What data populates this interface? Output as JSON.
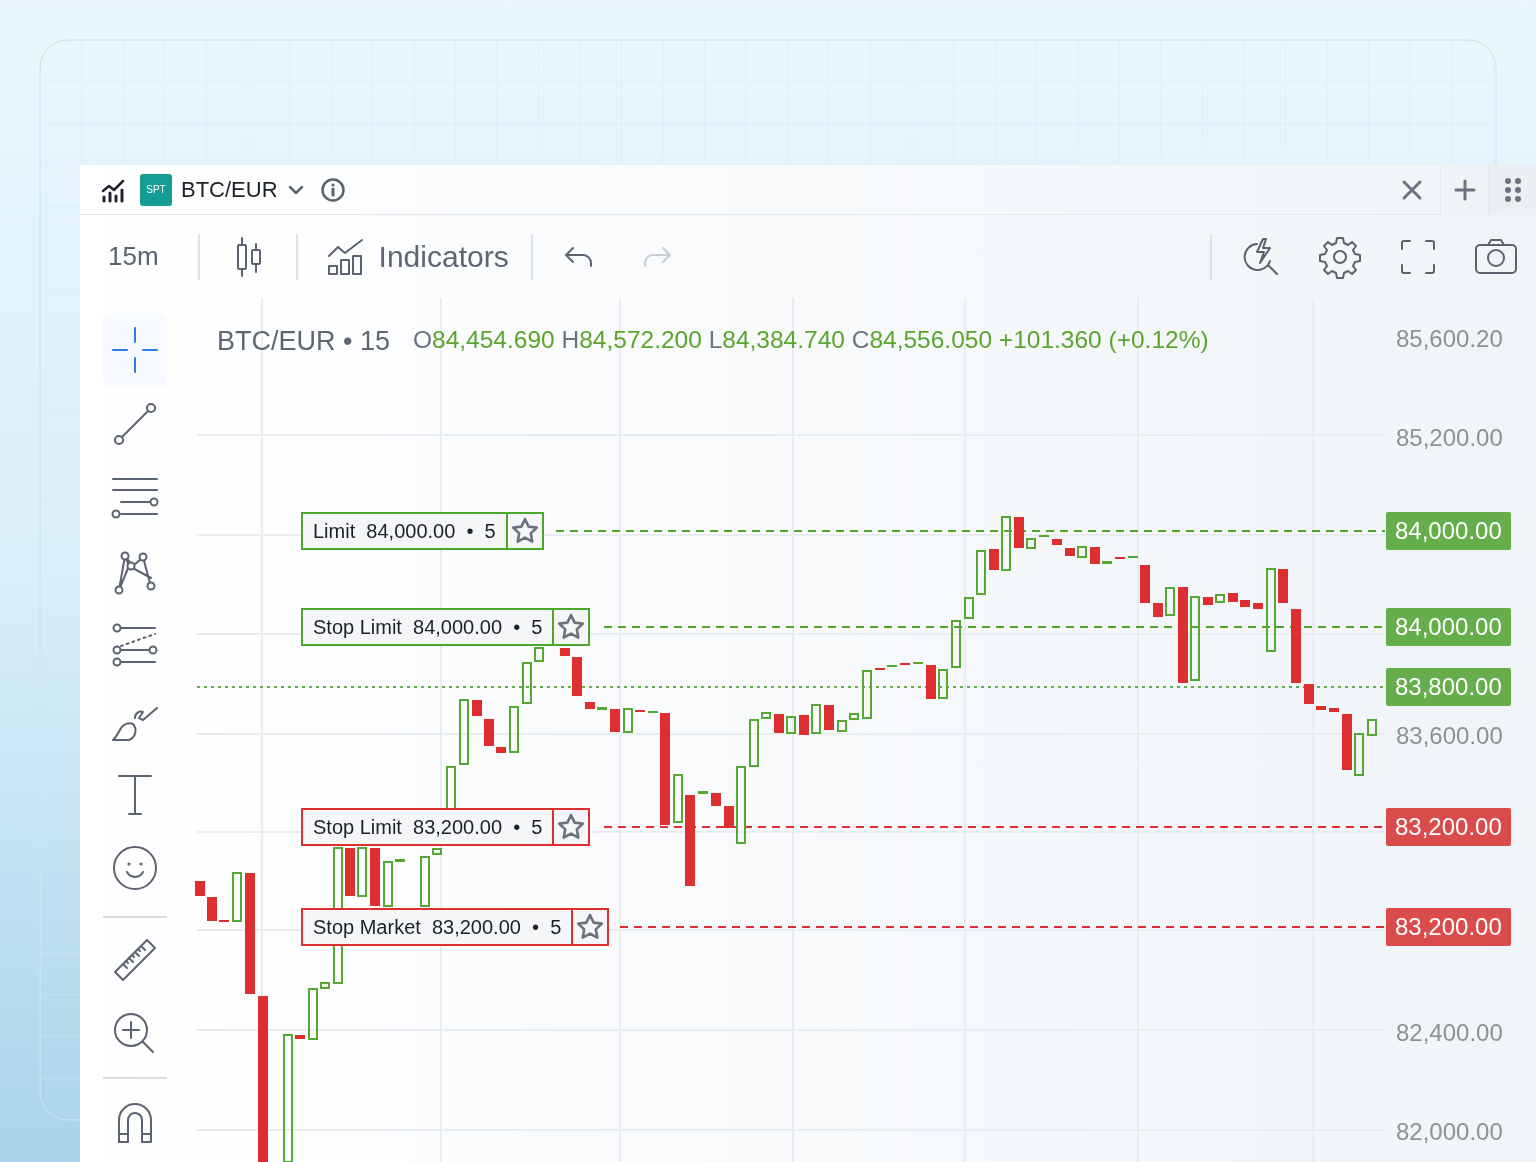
{
  "header": {
    "badge": "SPT",
    "symbol": "BTC/EUR"
  },
  "toolbar": {
    "interval": "15m",
    "indicators": "Indicators",
    "undo": {
      "disabled": false
    },
    "redo": {
      "disabled": true
    }
  },
  "tool_groups": [
    {
      "tools": [
        {
          "kind": "crosshair",
          "selected": true
        },
        {
          "kind": "trend-line",
          "selected": false
        },
        {
          "kind": "levels",
          "selected": false
        },
        {
          "kind": "pattern",
          "selected": false
        },
        {
          "kind": "channel",
          "selected": false
        },
        {
          "kind": "brush",
          "selected": false
        },
        {
          "kind": "text",
          "selected": false
        },
        {
          "kind": "emoji",
          "selected": false
        }
      ]
    },
    {
      "tools": [
        {
          "kind": "ruler",
          "selected": false
        },
        {
          "kind": "zoom",
          "selected": false
        }
      ]
    },
    {
      "tools": [
        {
          "kind": "magnet",
          "selected": false
        }
      ]
    }
  ],
  "legend": {
    "title": "BTC/EUR • 15",
    "values": [
      {
        "key": "O",
        "value": "84,454.690"
      },
      {
        "key": "H",
        "value": "84,572.200"
      },
      {
        "key": "L",
        "value": "84,384.740"
      },
      {
        "key": "C",
        "value": "84,556.050"
      }
    ],
    "change": "+101.360 (+0.12%)"
  },
  "orders": [
    {
      "text": "Limit  84,000.00  •  5",
      "color": "#4ea62a"
    },
    {
      "text": "Stop Limit  84,000.00  •  5",
      "color": "#4ea62a"
    },
    {
      "text": "Stop Limit  83,200.00  •  5",
      "color": "#dd2f2f"
    },
    {
      "text": "Stop Market  83,200.00  •  5",
      "color": "#dd2f2f"
    }
  ],
  "price_axis": [
    {
      "label": "85,600.20",
      "kind": "plain"
    },
    {
      "label": "85,200.00",
      "kind": "plain"
    },
    {
      "label": "84,000.00",
      "kind": "order",
      "color": "#66ad4b"
    },
    {
      "label": "84,000.00",
      "kind": "order",
      "color": "#66ad4b"
    },
    {
      "label": "83,800.00",
      "kind": "last",
      "color": "#66ad4b"
    },
    {
      "label": "83,600.00",
      "kind": "plain"
    },
    {
      "label": "83,200.00",
      "kind": "order",
      "color": "#da4c4c"
    },
    {
      "label": "83,200.00",
      "kind": "order",
      "color": "#da4c4c"
    },
    {
      "label": "82,400.00",
      "kind": "plain"
    },
    {
      "label": "82,000.00",
      "kind": "plain"
    }
  ]
}
